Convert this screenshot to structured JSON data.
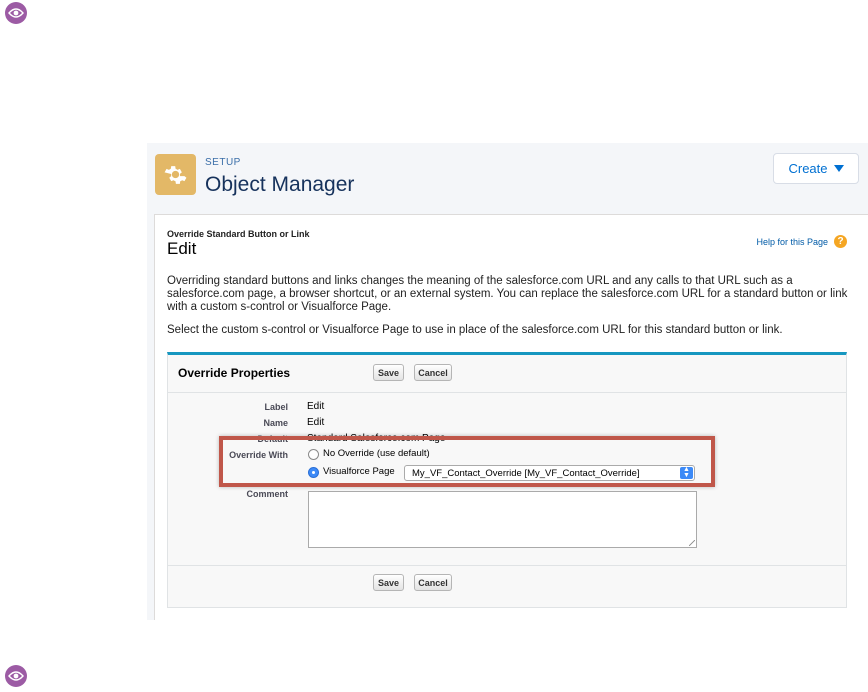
{
  "header": {
    "setup_label": "SETUP",
    "title": "Object Manager",
    "create_label": "Create"
  },
  "page": {
    "subtitle": "Override Standard Button or Link",
    "title": "Edit",
    "help_label": "Help for this Page",
    "description": "Overriding standard buttons and links changes the meaning of the salesforce.com URL and any calls to that URL such as a salesforce.com page, a browser shortcut, or an external system. You can replace the salesforce.com URL for a standard button or link with a custom s-control or Visualforce Page.",
    "instruction": "Select the custom s-control or Visualforce Page to use in place of the salesforce.com URL for this standard button or link."
  },
  "override_properties": {
    "title": "Override Properties",
    "save_label": "Save",
    "cancel_label": "Cancel",
    "fields": {
      "label_label": "Label",
      "label_value": "Edit",
      "name_label": "Name",
      "name_value": "Edit",
      "default_label": "Default",
      "default_value": "Standard Salesforce.com Page",
      "override_with_label": "Override With",
      "no_override_option": "No Override (use default)",
      "visualforce_option": "Visualforce Page",
      "visualforce_selected": "My_VF_Contact_Override [My_VF_Contact_Override]",
      "comment_label": "Comment"
    }
  },
  "colors": {
    "accent": "#1797c0",
    "highlight_border": "#c0574a",
    "setup_icon": "#e3b867",
    "eye_badge": "#9c5ba4"
  }
}
